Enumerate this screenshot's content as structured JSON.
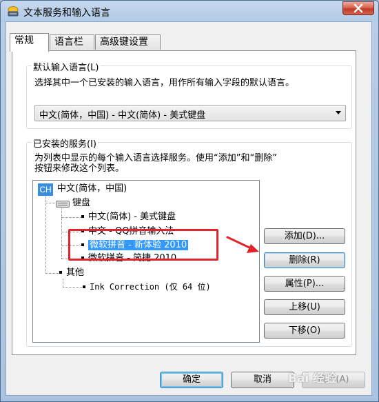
{
  "window": {
    "title": "文本服务和输入语言"
  },
  "tabs": [
    {
      "label": "常规",
      "active": true
    },
    {
      "label": "语言栏",
      "active": false
    },
    {
      "label": "高级键设置",
      "active": false
    }
  ],
  "default_language": {
    "group_label": "默认输入语言(L)",
    "description": "选择其中一个已安装的输入语言，用作所有输入字段的默认语言。",
    "selected_value": "中文(简体，中国) - 中文(简体) - 美式键盘"
  },
  "installed_services": {
    "group_label": "已安装的服务(I)",
    "description_line1": "为列表中显示的每个输入语言选择服务。使用“添加”和“删除”",
    "description_line2": "按钮来修改这个列表。",
    "tree": {
      "language": {
        "badge": "CH",
        "label": "中文(简体，中国)"
      },
      "keyboard_group": "键盘",
      "keyboards": [
        "中文(简体) - 美式键盘",
        "中文 - QQ拼音输入法",
        "微软拼音 - 新体验 2010",
        "微软拼音 - 简捷 2010"
      ],
      "selected_index": 2,
      "other_group": "其他",
      "other_items": [
        "Ink Correction (仅 64 位)"
      ]
    },
    "buttons": {
      "add": "添加(D)...",
      "remove": "删除(R)",
      "properties": "属性(P)...",
      "move_up": "上移(U)",
      "move_down": "下移(O)"
    }
  },
  "footer": {
    "ok": "确定",
    "cancel": "取消",
    "apply": "应用(A)"
  },
  "watermark": "Bai 经验",
  "colors": {
    "selection": "#3399ff",
    "annotation": "#e0242b",
    "ch_badge": "#3b8de0"
  }
}
